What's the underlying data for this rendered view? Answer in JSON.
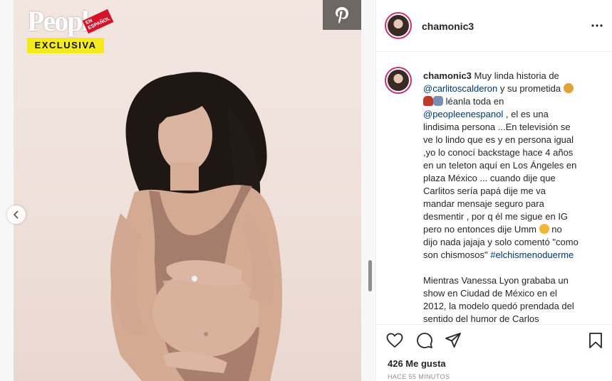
{
  "logo": {
    "word": "People",
    "badge": "EN ESPAÑOL",
    "tag": "EXCLUSIVA"
  },
  "post": {
    "username": "chamonic3",
    "caption_intro": "Muy linda historia de",
    "mention1": "@carlitoscalderon",
    "caption_part2": "y su prometida",
    "caption_part3": "léanla toda en",
    "mention2": "@peopleenespanol",
    "caption_part4": ", el es una lindisima persona ...En televisión se ve lo lindo que es y en persona igual ,yo lo conocí backstage hace 4 años en un teleton aquí en Los Ángeles en plaza México ... cuando dije que Carlitos sería papá dije me va mandar mensaje seguro para desmentir , por q él me sigue en IG pero no entonces dije Umm",
    "caption_part5": "no dijo nada jajaja y solo comentó \"como son chismosos\"",
    "hashtag": "#elchismenoduerme",
    "caption_para2": "Mientras Vanessa Lyon grababa un show en Ciudad de México en el 2012, la modelo quedó prendada del sentido del humor de Carlos Calderón",
    "likes": "426 Me gusta",
    "time": "HACE 55 MINUTOS"
  },
  "icons": {
    "pinterest": "pinterest-icon",
    "prev": "chevron-left-icon",
    "more": "more-dots-icon",
    "like": "heart-icon",
    "comment": "comment-icon",
    "share": "paper-plane-icon",
    "save": "bookmark-icon"
  },
  "colors": {
    "mention": "#00376b",
    "story_ring": "#c92f74",
    "exclusive_bg": "#f5ea1e"
  }
}
